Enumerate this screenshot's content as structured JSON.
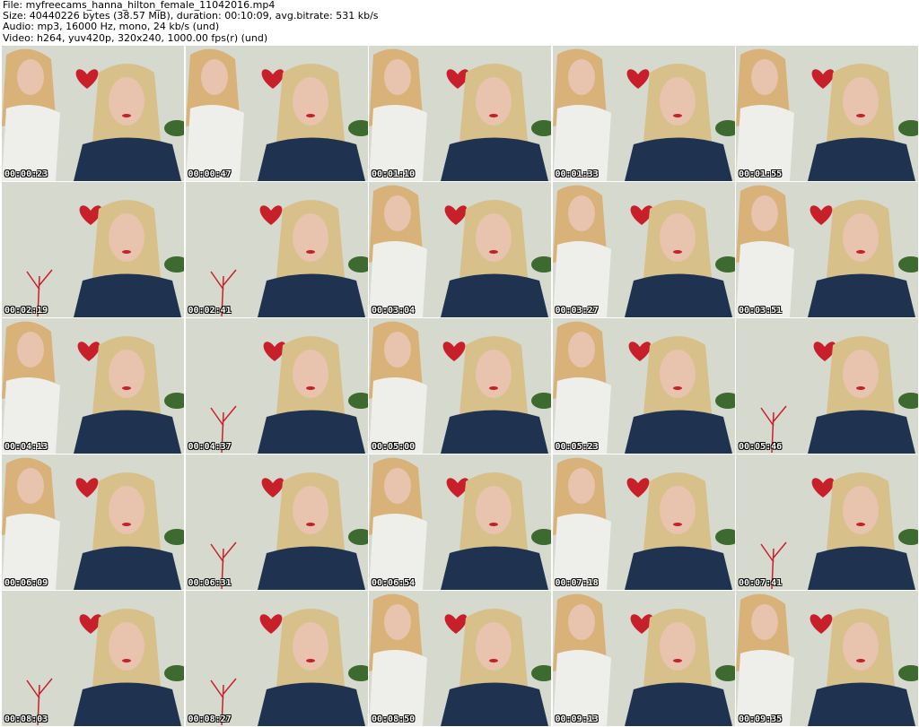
{
  "header": {
    "line1": "File: myfreecams_hanna_hilton_female_11042016.mp4",
    "line2": "Size: 40440226 bytes (38.57 MiB), duration: 00:10:09, avg.bitrate: 531 kb/s",
    "line3": "Audio: mp3, 16000 Hz, mono, 24 kb/s (und)",
    "line4": "Video: h264, yuv420p, 320x240, 1000.00 fps(r) (und)"
  },
  "colors": {
    "wall": "#d6d9ce",
    "heart": "#c8202a",
    "shirt": "#1f3350",
    "hair": "#d8c08a",
    "skin": "#e8c3ad",
    "plant": "#3d6a2e",
    "timestamp": "#ffffff"
  },
  "thumbnails": [
    {
      "time": "00:00:23"
    },
    {
      "time": "00:00:47"
    },
    {
      "time": "00:01:10"
    },
    {
      "time": "00:01:33"
    },
    {
      "time": "00:01:55"
    },
    {
      "time": "00:02:19"
    },
    {
      "time": "00:02:41"
    },
    {
      "time": "00:03:04"
    },
    {
      "time": "00:03:27"
    },
    {
      "time": "00:03:51"
    },
    {
      "time": "00:04:13"
    },
    {
      "time": "00:04:37"
    },
    {
      "time": "00:05:00"
    },
    {
      "time": "00:05:23"
    },
    {
      "time": "00:05:46"
    },
    {
      "time": "00:06:09"
    },
    {
      "time": "00:06:31"
    },
    {
      "time": "00:06:54"
    },
    {
      "time": "00:07:18"
    },
    {
      "time": "00:07:41"
    },
    {
      "time": "00:08:03"
    },
    {
      "time": "00:08:27"
    },
    {
      "time": "00:08:50"
    },
    {
      "time": "00:09:13"
    },
    {
      "time": "00:09:35"
    }
  ]
}
